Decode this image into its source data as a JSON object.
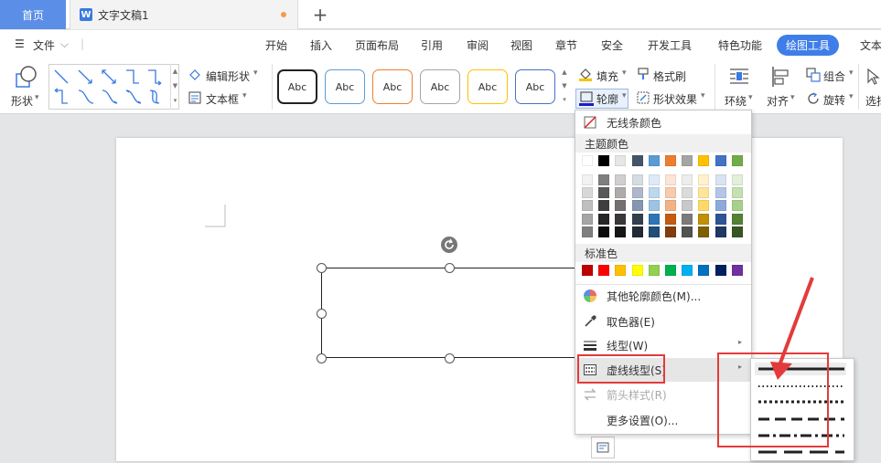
{
  "tabs": {
    "home": "首页",
    "doc": "文字文稿1",
    "doc_icon": "W"
  },
  "menu": [
    "文件",
    "开始",
    "插入",
    "页面布局",
    "引用",
    "审阅",
    "视图",
    "章节",
    "安全",
    "开发工具",
    "特色功能",
    "绘图工具",
    "文本"
  ],
  "ribbon": {
    "shape": "形状",
    "edit_shape": "编辑形状",
    "textbox": "文本框",
    "abc": "Abc",
    "fill": "填充",
    "outline": "轮廓",
    "format_brush": "格式刷",
    "shape_effect": "形状效果",
    "wrap": "环绕",
    "align": "对齐",
    "group": "组合",
    "rotate": "旋转",
    "select": "选择"
  },
  "abc_colors": [
    "#222222",
    "#5b9bd5",
    "#ed7d31",
    "#a5a5a5",
    "#ffc000",
    "#4472c4"
  ],
  "dropdown": {
    "no_line": "无线条颜色",
    "theme_colors": "主题颜色",
    "standard_colors": "标准色",
    "more_colors": "其他轮廓颜色(M)...",
    "picker": "取色器(E)",
    "line_type": "线型(W)",
    "dash_type": "虚线线型(S)",
    "arrow_style": "箭头样式(R)",
    "more_settings": "更多设置(O)..."
  },
  "theme_top": [
    "#ffffff",
    "#000000",
    "#e7e6e6",
    "#44546a",
    "#5b9bd5",
    "#ed7d31",
    "#a5a5a5",
    "#ffc000",
    "#4472c4",
    "#70ad47"
  ],
  "theme_shades": [
    [
      "#f2f2f2",
      "#7f7f7f",
      "#d0cece",
      "#d6dce4",
      "#deebf6",
      "#fbe5d5",
      "#ededed",
      "#fff2cc",
      "#dae3f3",
      "#e2efd9"
    ],
    [
      "#d8d8d8",
      "#595959",
      "#aeabab",
      "#adb9ca",
      "#bdd7ee",
      "#f7cbac",
      "#dbdbdb",
      "#ffe598",
      "#b4c6e7",
      "#c5e0b3"
    ],
    [
      "#bfbfbf",
      "#3f3f3f",
      "#757070",
      "#8496b0",
      "#9cc3e5",
      "#f4b183",
      "#c9c9c9",
      "#ffd965",
      "#8eaadb",
      "#a8d08d"
    ],
    [
      "#a5a5a5",
      "#262626",
      "#3a3838",
      "#323f4f",
      "#2e75b5",
      "#c55a11",
      "#7b7b7b",
      "#bf9000",
      "#2f5496",
      "#538135"
    ],
    [
      "#7f7f7f",
      "#0c0c0c",
      "#171616",
      "#222a35",
      "#1f4e79",
      "#833c0b",
      "#525252",
      "#7f6000",
      "#1f3864",
      "#375623"
    ]
  ],
  "standard": [
    "#c00000",
    "#ff0000",
    "#ffc000",
    "#ffff00",
    "#92d050",
    "#00b050",
    "#00b0f0",
    "#0070c0",
    "#002060",
    "#7030a0"
  ]
}
